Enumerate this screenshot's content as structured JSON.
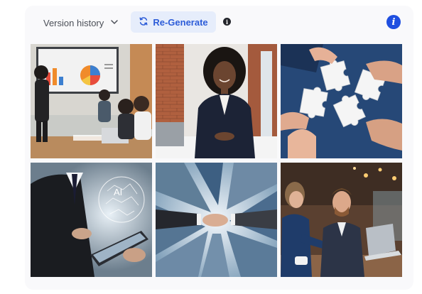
{
  "toolbar": {
    "version_history_label": "Version history",
    "regenerate_label": "Re-Generate",
    "small_info_glyph": "i",
    "big_info_glyph": "i"
  },
  "images": [
    {
      "id": "img-1",
      "subject": "team presentation in meeting room with pie chart on screen"
    },
    {
      "id": "img-2",
      "subject": "smiling businesswoman in navy suit at desk with laptop"
    },
    {
      "id": "img-3",
      "subject": "hands connecting white jigsaw puzzle pieces"
    },
    {
      "id": "img-4",
      "subject": "businessman using tablet with glowing AI head"
    },
    {
      "id": "img-5",
      "subject": "handshake between skyscrapers viewed from below"
    },
    {
      "id": "img-6",
      "subject": "man and woman in cafe pointing at laptop"
    }
  ],
  "ai_text": "AI",
  "colors": {
    "accent": "#2c5cd8",
    "accent_bg": "#e6edfb",
    "info_blue": "#1f4fe0"
  }
}
